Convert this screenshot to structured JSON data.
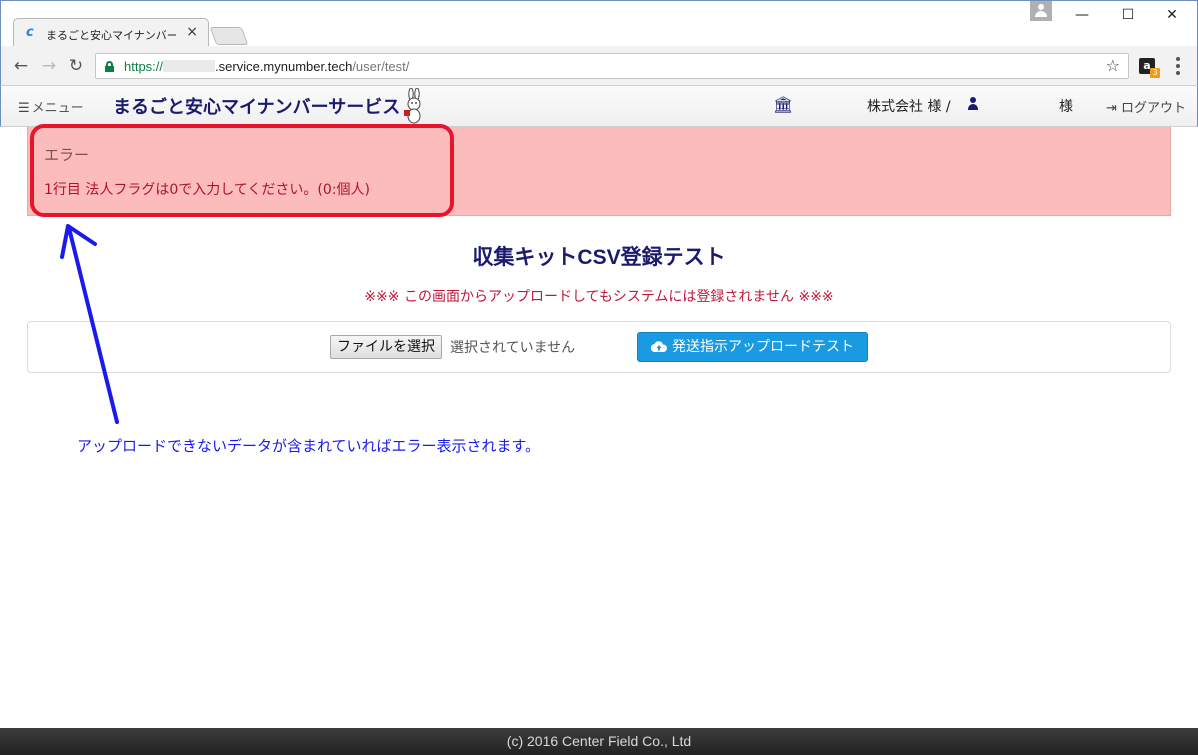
{
  "browser": {
    "tab_title": "まるごと安心マイナンバー",
    "tab_close": "×",
    "url_scheme": "https://",
    "url_host": ".service.mynumber.tech",
    "url_path": "/user/test/",
    "back": "←",
    "forward": "→",
    "reload": "↻",
    "star": "☆",
    "extension_label": "a",
    "extension_badge": "3",
    "minimize": "—",
    "maximize": "☐",
    "close": "✕"
  },
  "header": {
    "menu_label": "メニュー",
    "brand": "まるごと安心マイナンバーサービス",
    "company_suffix": "株式会社 様 /",
    "user_suffix": "様",
    "logout_label": "ログアウト"
  },
  "alert": {
    "title": "エラー",
    "message": "1行目 法人フラグは0で入力してください。(0:個人)"
  },
  "page": {
    "title": "収集キットCSV登録テスト",
    "note": "※※※ この画面からアップロードしてもシステムには登録されません ※※※",
    "file_button": "ファイルを選択",
    "file_status": "選択されていません",
    "upload_button": "発送指示アップロードテスト"
  },
  "annotation": {
    "text": "アップロードできないデータが含まれていればエラー表示されます。"
  },
  "footer": {
    "copyright": "(c) 2016 Center Field Co., Ltd"
  },
  "colors": {
    "alert_bg": "#fcbcbc",
    "highlight": "#e8142c",
    "annotation": "#1a1aee",
    "primary_button": "#1a9ae0",
    "brand_navy": "#1a1a6e"
  }
}
